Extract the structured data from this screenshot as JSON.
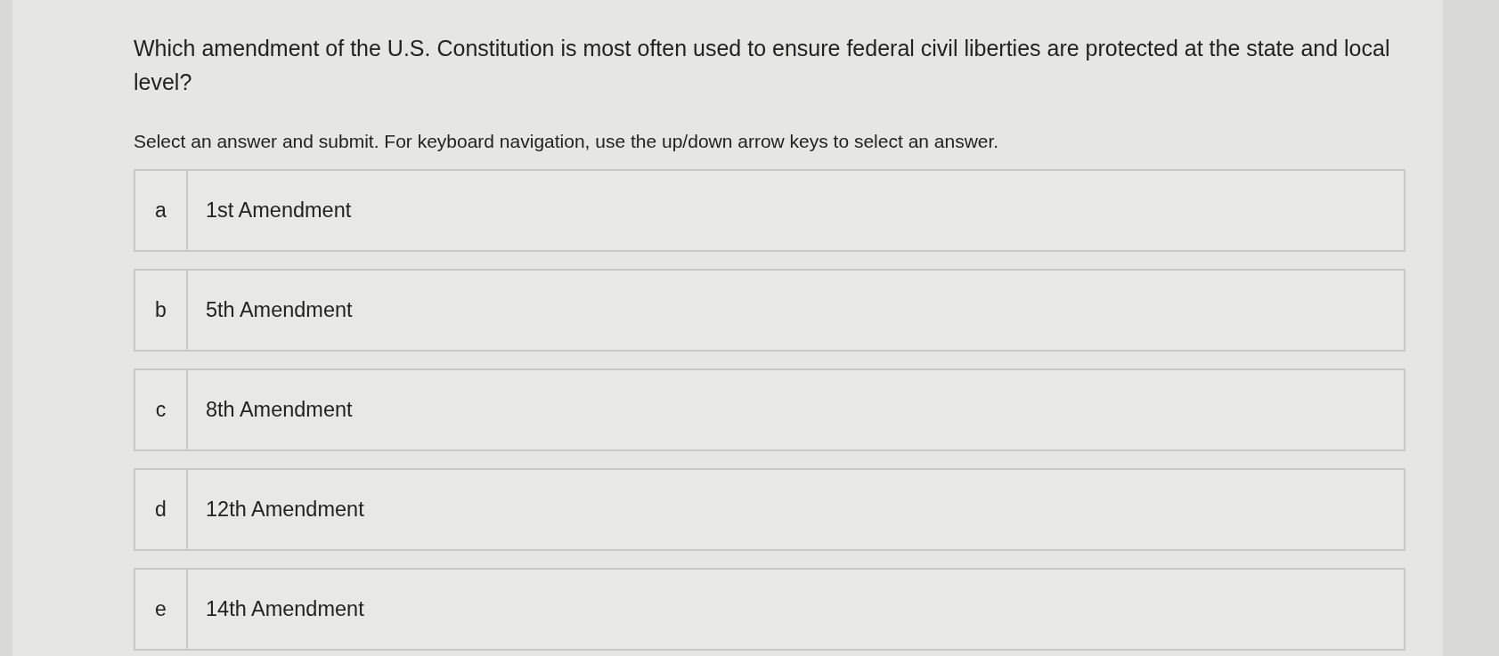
{
  "question": "Which amendment of the U.S. Constitution is most often used to ensure federal civil liberties are protected at the state and local level?",
  "instructions": "Select an answer and submit. For keyboard navigation, use the up/down arrow keys to select an answer.",
  "options": [
    {
      "letter": "a",
      "label": "1st Amendment",
      "selected": false
    },
    {
      "letter": "b",
      "label": "5th Amendment",
      "selected": false
    },
    {
      "letter": "c",
      "label": "8th Amendment",
      "selected": false
    },
    {
      "letter": "d",
      "label": "12th Amendment",
      "selected": false
    },
    {
      "letter": "e",
      "label": "14th Amendment",
      "selected": false
    }
  ]
}
